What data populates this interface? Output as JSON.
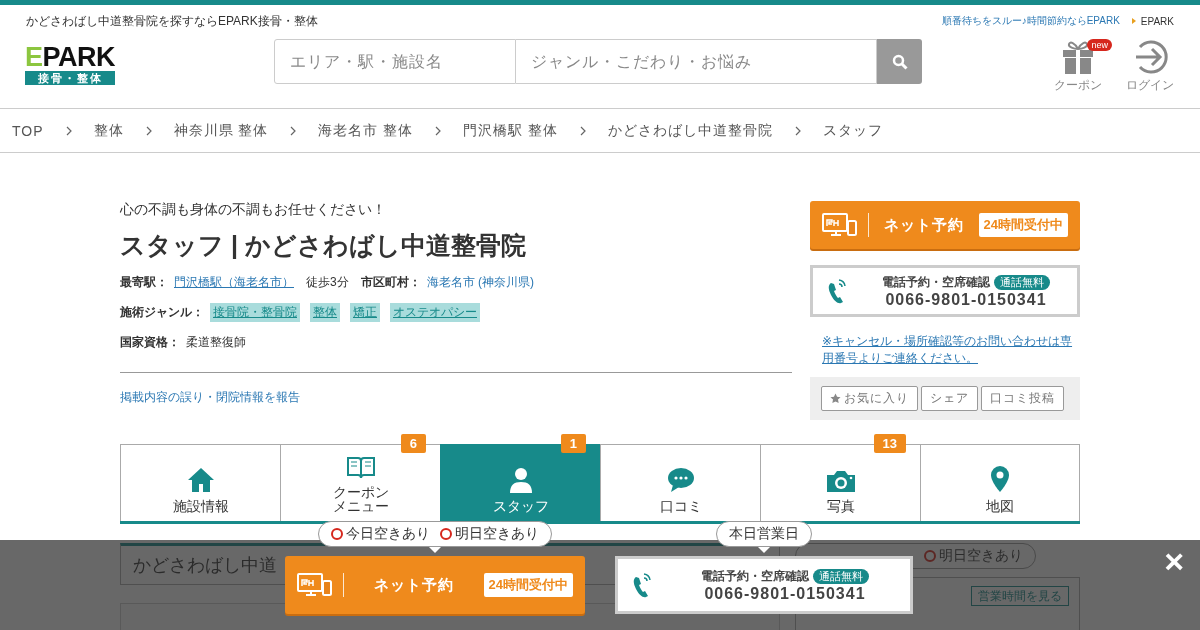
{
  "header": {
    "tagline": "かどさわばし中道整骨院を探すならEPARK接骨・整体",
    "promo_link": "順番待ちをスルー♪時間節約ならEPARK",
    "brand_link": "EPARK",
    "logo": {
      "wordmark": "EPARK",
      "subtitle": "接骨・整体"
    },
    "search": {
      "area_placeholder": "エリア・駅・施設名",
      "genre_placeholder": "ジャンル・こだわり・お悩み"
    },
    "icons": [
      {
        "kind": "gift",
        "label": "クーポン",
        "badge": "new"
      },
      {
        "kind": "login",
        "label": "ログイン"
      }
    ]
  },
  "breadcrumb": [
    "TOP",
    "整体",
    "神奈川県 整体",
    "海老名市 整体",
    "門沢橋駅 整体",
    "かどさわばし中道整骨院",
    "スタッフ"
  ],
  "clinic": {
    "catchphrase": "心の不調も身体の不調もお任せください！",
    "title": "スタッフ | かどさわばし中道整骨院",
    "station_label": "最寄駅：",
    "station": "門沢橋駅（海老名市）",
    "walk": "徒歩3分",
    "city_label": "市区町村：",
    "city": "海老名市 (神奈川県)",
    "genre_label": "施術ジャンル：",
    "genres": [
      "接骨院・整骨院",
      "整体",
      "矯正",
      "オステオパシー"
    ],
    "license_label": "国家資格：",
    "license": "柔道整復師",
    "report_link": "掲載内容の誤り・閉院情報を報告"
  },
  "sidebar": {
    "net_button": {
      "label": "ネット予約",
      "badge": "24時間受付中"
    },
    "phone": {
      "label": "電話予約・空席確認",
      "badge": "通話無料",
      "number": "0066-9801-0150341"
    },
    "notice": "※キャンセル・場所確認等のお問い合わせは専用番号よりご連絡ください。",
    "actions": [
      {
        "kind": "favorite",
        "label": "お気に入り"
      },
      {
        "kind": "plain",
        "label": "シェア"
      },
      {
        "kind": "plain",
        "label": "口コミ投稿"
      }
    ]
  },
  "tabs": [
    {
      "kind": "home",
      "label": "施設情報",
      "selected": false
    },
    {
      "kind": "book",
      "label": "クーポンメニュー",
      "count": "6",
      "selected": false
    },
    {
      "kind": "person",
      "label": "スタッフ",
      "count": "1",
      "selected": true
    },
    {
      "kind": "chat",
      "label": "口コミ",
      "selected": false
    },
    {
      "kind": "camera",
      "label": "写真",
      "count": "13",
      "selected": false
    },
    {
      "kind": "pin",
      "label": "地図",
      "selected": false
    }
  ],
  "background": {
    "section_heading": "かどさわばし中道",
    "availability": [
      "明日空きあり"
    ],
    "hours_button": "営業時間を見る"
  },
  "bottom_bar": {
    "net_bubble": [
      "今日空きあり",
      "明日空きあり"
    ],
    "net_button": {
      "label": "ネット予約",
      "badge": "24時間受付中"
    },
    "phone_bubble": "本日営業日",
    "phone": {
      "label": "電話予約・空席確認",
      "badge": "通話無料",
      "number": "0066-9801-0150341"
    },
    "close": "×"
  }
}
